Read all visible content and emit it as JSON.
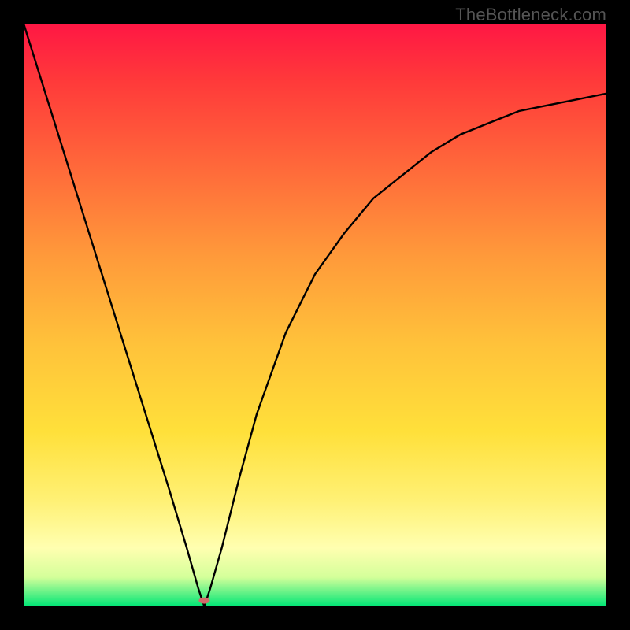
{
  "watermark": "TheBottleneck.com",
  "chart_data": {
    "type": "line",
    "title": "",
    "xlabel": "",
    "ylabel": "",
    "xlim": [
      0,
      100
    ],
    "ylim": [
      0,
      100
    ],
    "minimum_point": {
      "x": 31,
      "y": 0
    },
    "marker": {
      "x": 31,
      "y": 1,
      "color": "#d46a6a"
    },
    "series": [
      {
        "name": "curve",
        "x": [
          0,
          5,
          10,
          15,
          20,
          25,
          28,
          30,
          31,
          32,
          34,
          37,
          40,
          45,
          50,
          55,
          60,
          65,
          70,
          75,
          80,
          85,
          90,
          95,
          100
        ],
        "y": [
          100,
          84,
          68,
          52,
          36,
          20,
          10,
          3,
          0,
          3,
          10,
          22,
          33,
          47,
          57,
          64,
          70,
          74,
          78,
          81,
          83,
          85,
          86,
          87,
          88
        ]
      }
    ],
    "gradient_stops": [
      {
        "pos": 0,
        "color": "#ff1744"
      },
      {
        "pos": 10,
        "color": "#ff3a3a"
      },
      {
        "pos": 25,
        "color": "#ff6a3a"
      },
      {
        "pos": 40,
        "color": "#ff9a3a"
      },
      {
        "pos": 55,
        "color": "#ffc23a"
      },
      {
        "pos": 70,
        "color": "#ffe03a"
      },
      {
        "pos": 82,
        "color": "#fff176"
      },
      {
        "pos": 90,
        "color": "#ffffb0"
      },
      {
        "pos": 95,
        "color": "#d4ff9a"
      },
      {
        "pos": 100,
        "color": "#00e676"
      }
    ]
  }
}
